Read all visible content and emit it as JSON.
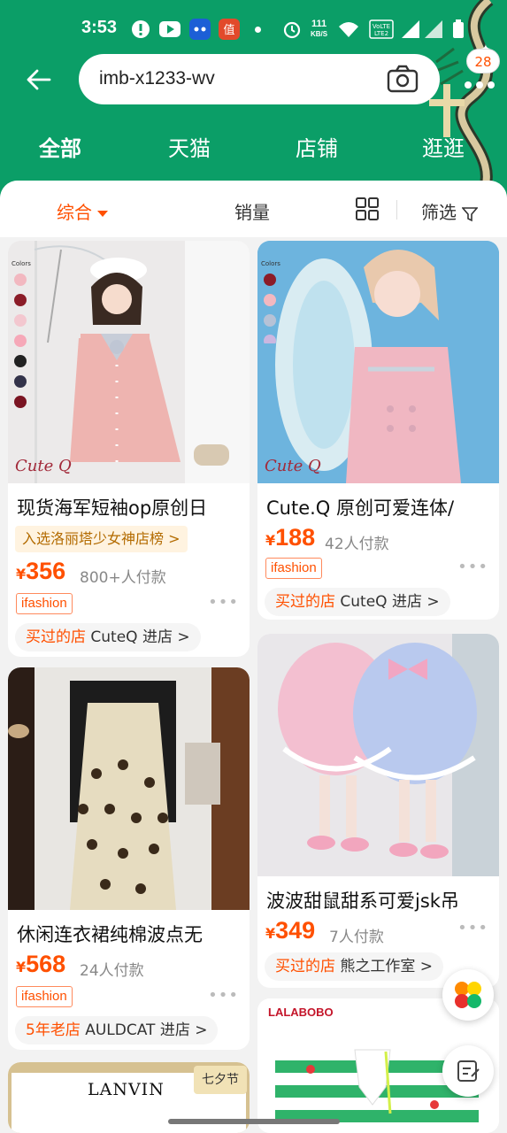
{
  "status_bar": {
    "time": "3:53",
    "net_speed": "111",
    "net_unit": "KB/S"
  },
  "search": {
    "query": "imb-x1233-wv",
    "badge_count": "28"
  },
  "tabs": [
    {
      "label": "全部"
    },
    {
      "label": "天猫"
    },
    {
      "label": "店铺"
    },
    {
      "label": "逛逛"
    }
  ],
  "sort": {
    "comprehensive": "综合",
    "sales": "销量",
    "filter": "筛选"
  },
  "products": [
    {
      "title": "现货海军短袖op原创日",
      "rank": "入选洛丽塔少女神店榜 >",
      "currency": "¥",
      "price": "356",
      "sold": "800+人付款",
      "tag": "ifashion",
      "shop_prefix": "买过的店",
      "shop_name": "CuteQ 进店 >",
      "colors_label": "Colors",
      "brand_mark": "Cute Q"
    },
    {
      "title": "Cute.Q 原创可爱连体/",
      "currency": "¥",
      "price": "188",
      "sold": "42人付款",
      "tag": "ifashion",
      "shop_prefix": "买过的店",
      "shop_name": "CuteQ 进店 >",
      "colors_label": "Colors",
      "brand_mark": "Cute Q"
    },
    {
      "title": "休闲连衣裙纯棉波点无",
      "currency": "¥",
      "price": "568",
      "sold": "24人付款",
      "tag": "ifashion",
      "shop_prefix": "5年老店",
      "shop_name": "AULDCAT 进店 >"
    },
    {
      "title": "波波甜鼠甜系可爱jsk吊",
      "currency": "¥",
      "price": "349",
      "sold": "7人付款",
      "shop_prefix": "买过的店",
      "shop_name": "熊之工作室 >"
    },
    {
      "brand": "LANVIN",
      "corner_badge": "七夕节"
    },
    {
      "brand": "LALABOBO"
    }
  ],
  "colors": {
    "brand_green": "#0b9e67",
    "accent_orange": "#ff5000"
  }
}
